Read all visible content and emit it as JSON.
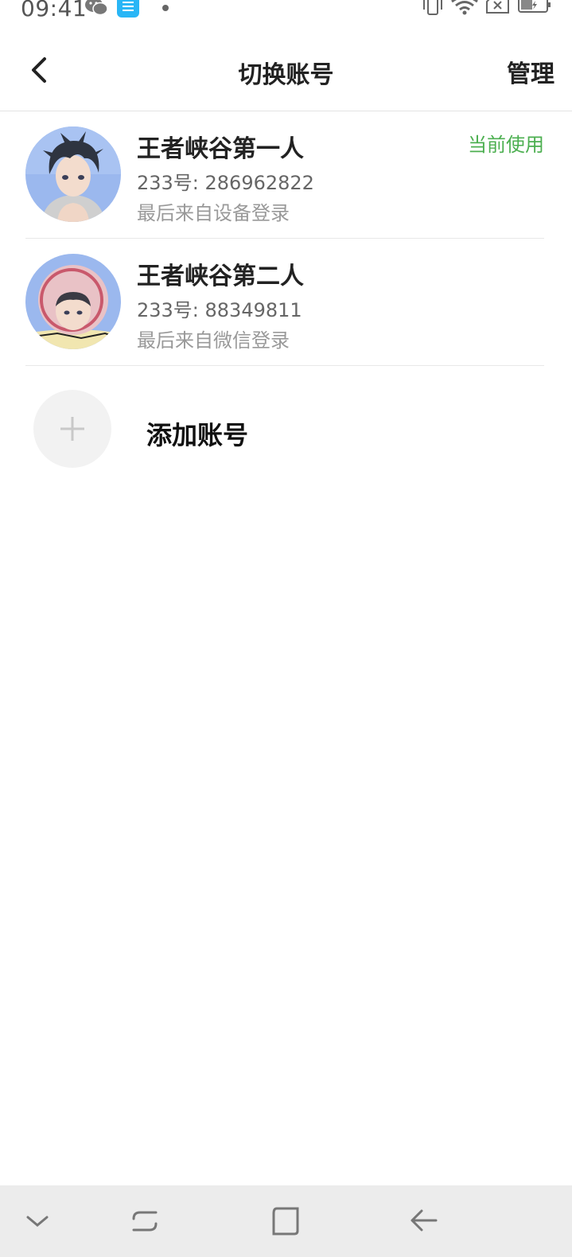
{
  "status_bar": {
    "time": "09:41",
    "icons": [
      "wechat-icon",
      "notes-app-icon",
      "dot-icon",
      "vibrate-icon",
      "wifi-icon",
      "sim-x-icon",
      "battery-icon"
    ]
  },
  "header": {
    "back_icon": "chevron-left-icon",
    "title": "切换账号",
    "manage_label": "管理"
  },
  "accounts": [
    {
      "name": "王者峡谷第一人",
      "id_text": "233号: 286962822",
      "login_text": "最后来自设备登录",
      "badge": "当前使用"
    },
    {
      "name": "王者峡谷第二人",
      "id_text": "233号: 88349811",
      "login_text": "最后来自微信登录",
      "badge": ""
    }
  ],
  "add_account": {
    "icon": "plus-icon",
    "label": "添加账号"
  },
  "nav_bar": {
    "buttons": [
      "chevron-down-icon",
      "recent-apps-icon",
      "home-icon",
      "back-arrow-icon"
    ]
  },
  "colors": {
    "accent_green": "#4caf50",
    "avatar_bg": "#9bb8ee",
    "add_circle_bg": "#f2f2f2",
    "nav_bg": "#ececec"
  }
}
